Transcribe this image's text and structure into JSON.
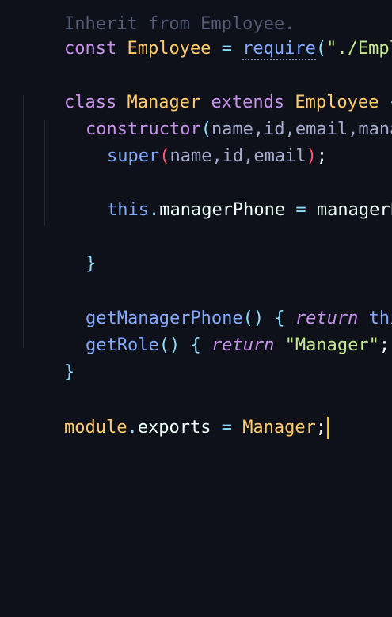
{
  "editor": {
    "lines": [
      {
        "text": "Inherit from Employee."
      },
      {
        "t1": "const",
        "t2": "Employee",
        "t3": "=",
        "t4": "require",
        "t5": "(",
        "t6": "\"./Employ"
      },
      {
        "t1": "class",
        "t2": "Manager",
        "t3": "extends",
        "t4": "Employee",
        "t5": "{"
      },
      {
        "t1": "constructor",
        "t2": "(",
        "t3": "name,id,email,manage"
      },
      {
        "t1": "super",
        "t2": "(",
        "t3": "name,id,email",
        "t4": ")",
        "t5": ";"
      },
      {
        "t1": "this",
        "t2": ".",
        "t3": "managerPhone",
        "t4": "=",
        "t5": "managerPho"
      },
      {
        "t1": "}"
      },
      {
        "t1": "getManagerPhone",
        "t2": "()",
        "t3": "{",
        "t4": "return",
        "t5": "this."
      },
      {
        "t1": "getRole",
        "t2": "()",
        "t3": "{",
        "t4": "return",
        "t5": "\"Manager\"",
        "t6": ";",
        "t7": "}"
      },
      {
        "t1": "}"
      },
      {
        "t1": "module",
        "t2": ".",
        "t3": "exports",
        "t4": "=",
        "t5": "Manager",
        "t6": ";"
      }
    ],
    "colors": {
      "background": "#0f111a",
      "keyword": "#c792ea",
      "class_name": "#ffcb6b",
      "function": "#82aaff",
      "string": "#c3e88d",
      "cursor": "#ffcc00"
    }
  }
}
